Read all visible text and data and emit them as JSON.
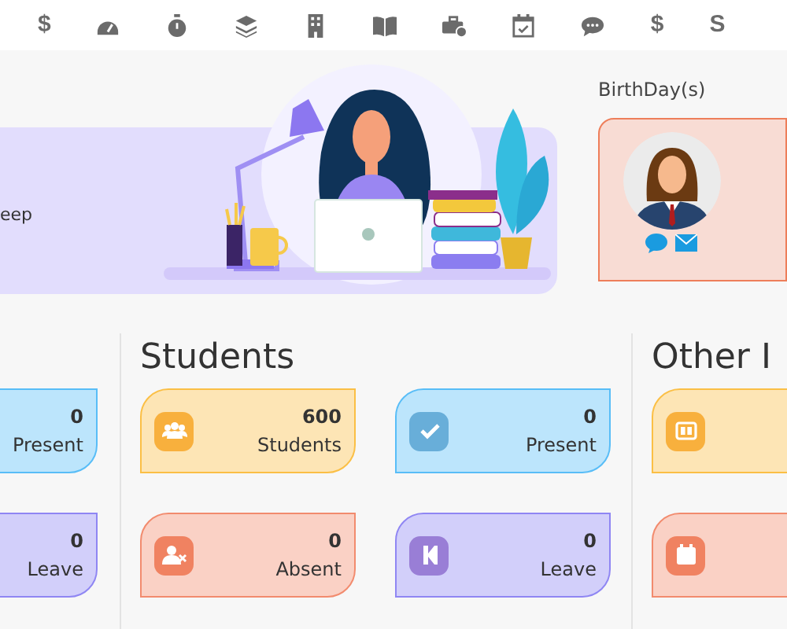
{
  "toolbar": [
    {
      "kind": "glyph",
      "text": "$"
    },
    {
      "kind": "icon"
    },
    {
      "kind": "icon"
    },
    {
      "kind": "icon"
    },
    {
      "kind": "icon"
    },
    {
      "kind": "icon"
    },
    {
      "kind": "icon"
    },
    {
      "kind": "icon"
    },
    {
      "kind": "icon"
    },
    {
      "kind": "glyph",
      "text": "$"
    },
    {
      "kind": "glyph",
      "text": "S"
    }
  ],
  "banner": {
    "text": "eep"
  },
  "birthdays": {
    "title": "BirthDay(s)"
  },
  "sections": [
    {
      "cards": [
        {
          "value": "0",
          "label": "Present",
          "color": "#58bdf7"
        },
        {
          "value": "0",
          "label": "Leave",
          "color": "#8f86f3"
        }
      ]
    },
    {
      "title": "Students",
      "cards": [
        {
          "value": "600",
          "label": "Students",
          "color": "#fbbf45"
        },
        {
          "value": "0",
          "label": "Present",
          "color": "#58bdf7"
        },
        {
          "value": "0",
          "label": "Absent",
          "color": "#f28b6e"
        },
        {
          "value": "0",
          "label": "Leave",
          "color": "#8f86f3"
        }
      ]
    },
    {
      "title": "Other I",
      "cards": [
        {
          "color": "#fbbf45"
        },
        {
          "color": "#f28b6e"
        }
      ]
    }
  ]
}
